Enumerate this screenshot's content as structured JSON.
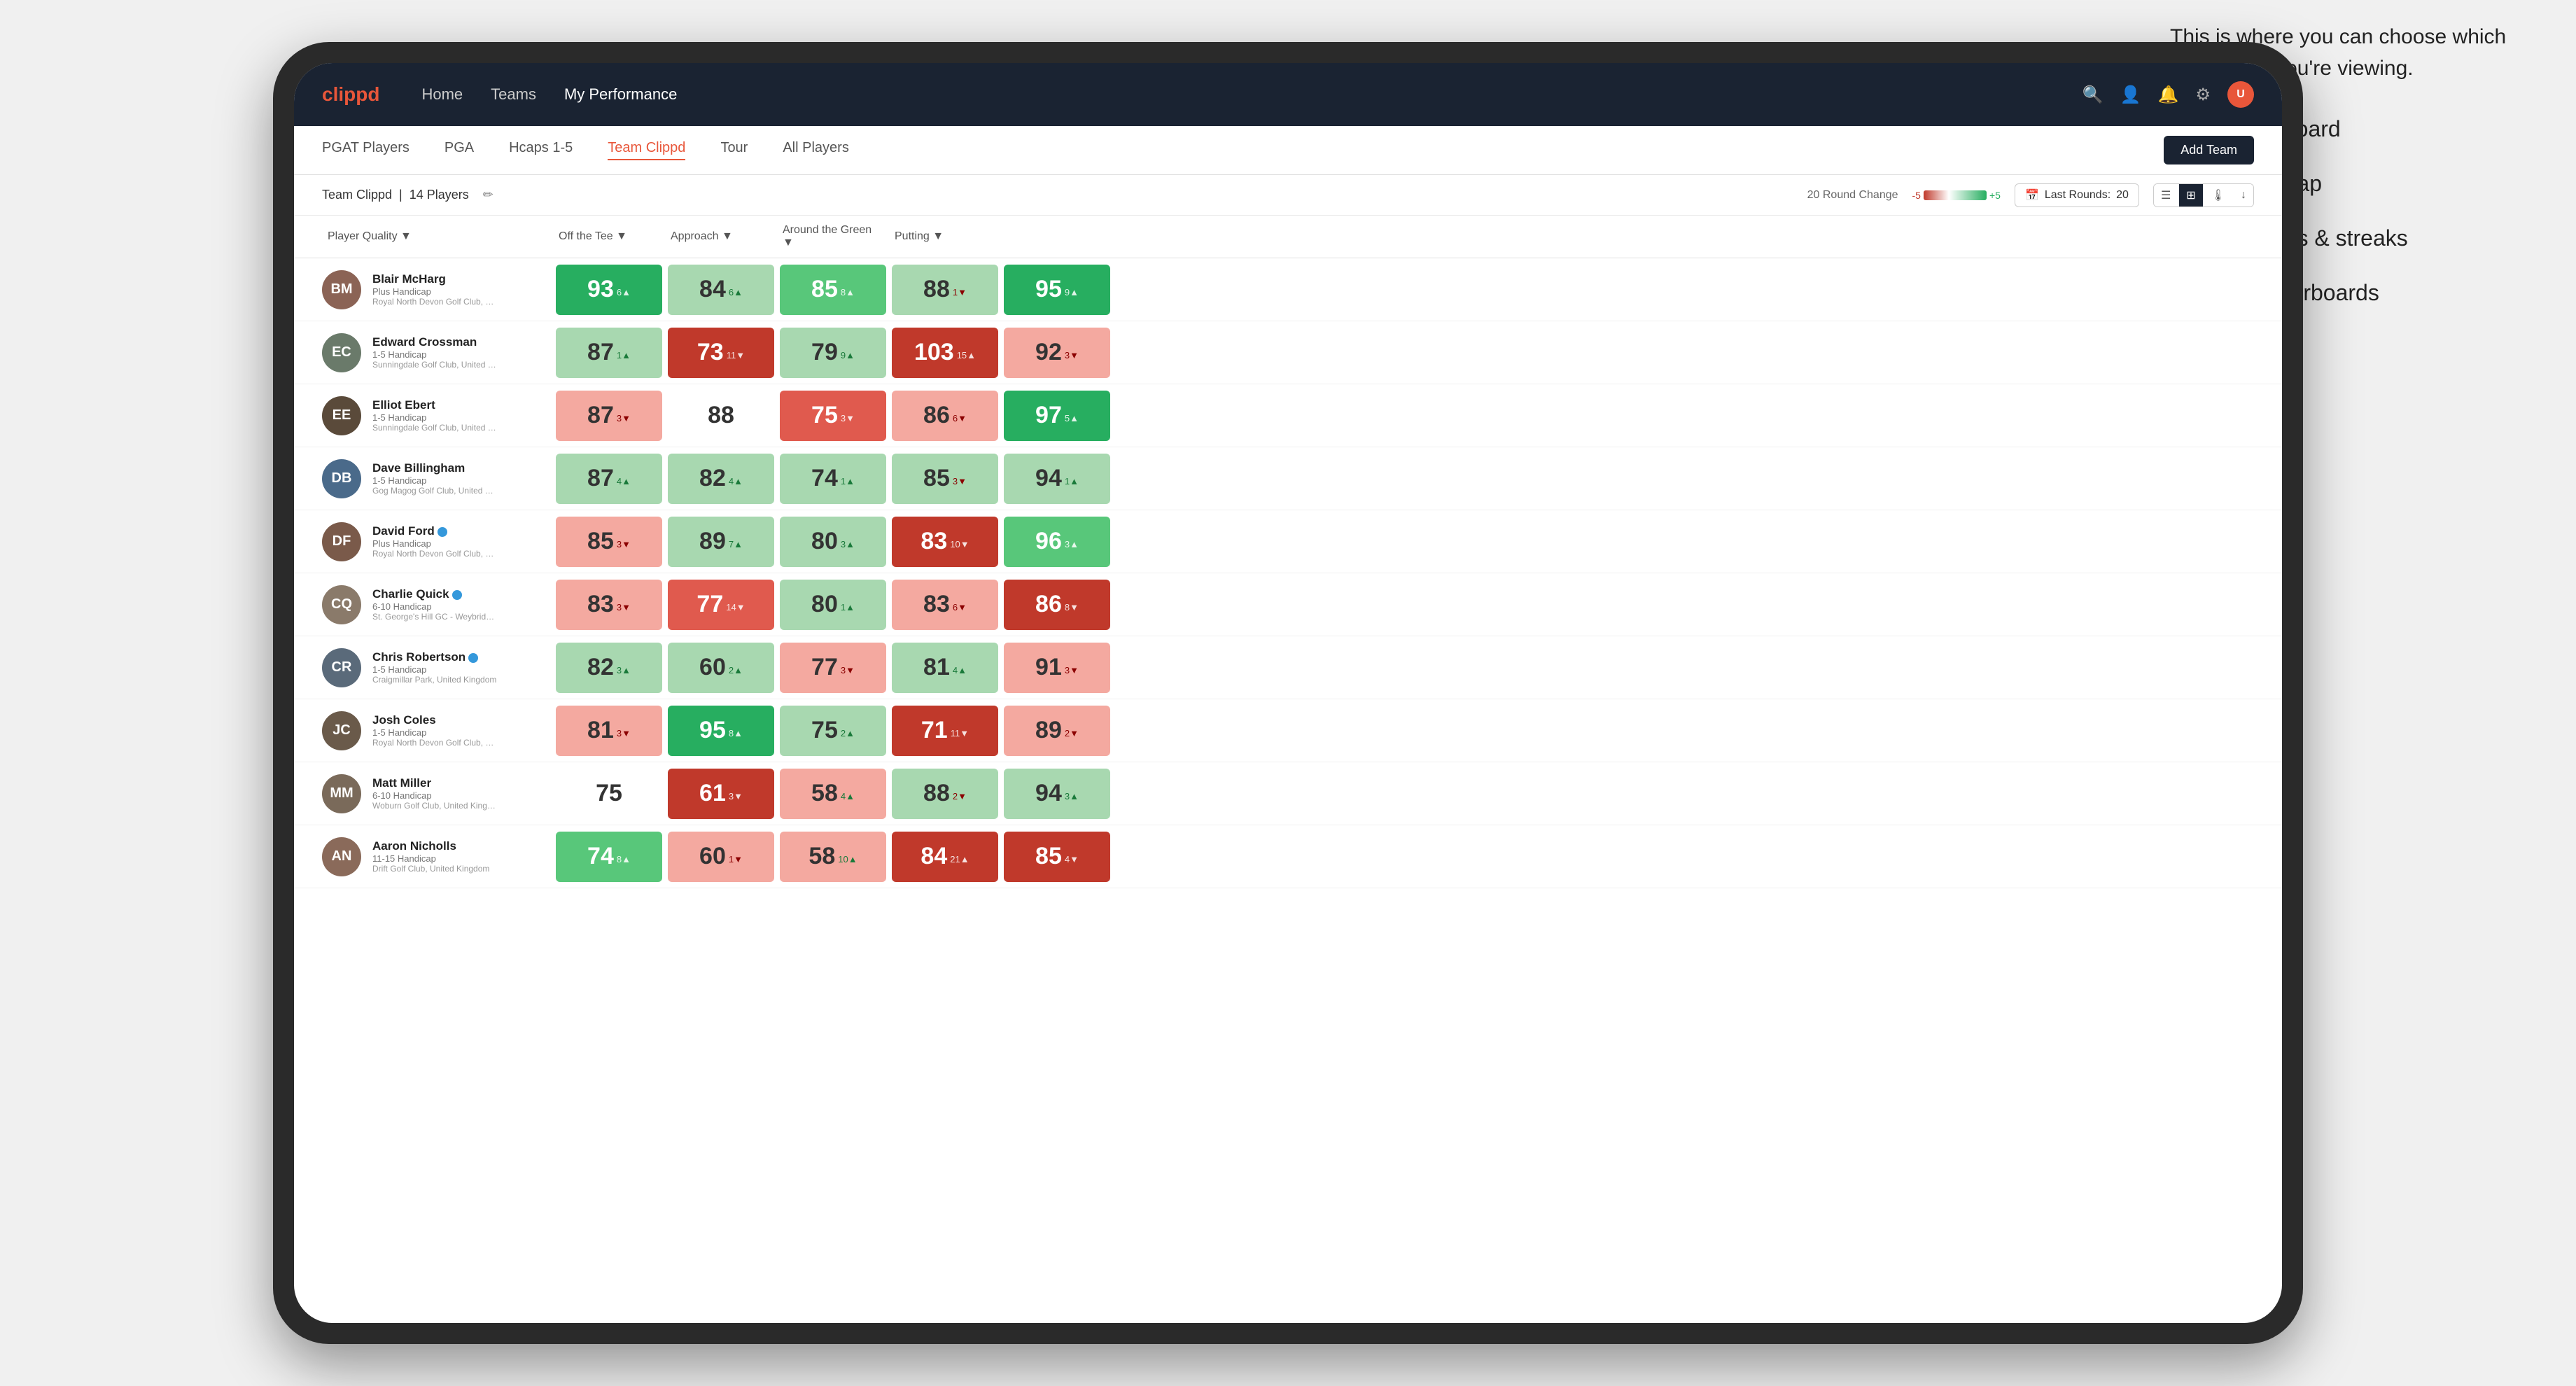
{
  "annotation": {
    "intro": "This is where you can choose which dashboard you're viewing.",
    "items": [
      "Team Dashboard",
      "Team Heatmap",
      "Leaderboards & streaks",
      "Course leaderboards"
    ]
  },
  "nav": {
    "logo": "clippd",
    "links": [
      "Home",
      "Teams",
      "My Performance"
    ],
    "active_link": "My Performance"
  },
  "sub_nav": {
    "links": [
      "PGAT Players",
      "PGA",
      "Hcaps 1-5",
      "Team Clippd",
      "Tour",
      "All Players"
    ],
    "active": "Team Clippd",
    "add_team_label": "Add Team"
  },
  "team_bar": {
    "name": "Team Clippd",
    "count": "14 Players",
    "round_change_label": "20 Round Change",
    "scale_neg": "-5",
    "scale_pos": "+5",
    "last_rounds_label": "Last Rounds:",
    "last_rounds_value": "20"
  },
  "table": {
    "columns": [
      "Player Quality ▼",
      "Off the Tee ▼",
      "Approach ▼",
      "Around the Green ▼",
      "Putting ▼"
    ],
    "players": [
      {
        "name": "Blair McHarg",
        "handicap": "Plus Handicap",
        "club": "Royal North Devon Golf Club, United Kingdom",
        "avatar_color": "#8B6355",
        "scores": [
          {
            "value": "93",
            "delta": "6",
            "dir": "up",
            "color": "green-dark"
          },
          {
            "value": "84",
            "delta": "6",
            "dir": "up",
            "color": "green-light"
          },
          {
            "value": "85",
            "delta": "8",
            "dir": "up",
            "color": "green-med"
          },
          {
            "value": "88",
            "delta": "1",
            "dir": "down",
            "color": "green-light"
          },
          {
            "value": "95",
            "delta": "9",
            "dir": "up",
            "color": "green-dark"
          }
        ]
      },
      {
        "name": "Edward Crossman",
        "handicap": "1-5 Handicap",
        "club": "Sunningdale Golf Club, United Kingdom",
        "avatar_color": "#6a7a6a",
        "scores": [
          {
            "value": "87",
            "delta": "1",
            "dir": "up",
            "color": "green-light"
          },
          {
            "value": "73",
            "delta": "11",
            "dir": "down",
            "color": "red-dark"
          },
          {
            "value": "79",
            "delta": "9",
            "dir": "up",
            "color": "green-light"
          },
          {
            "value": "103",
            "delta": "15",
            "dir": "up",
            "color": "red-dark"
          },
          {
            "value": "92",
            "delta": "3",
            "dir": "down",
            "color": "red-light"
          }
        ]
      },
      {
        "name": "Elliot Ebert",
        "handicap": "1-5 Handicap",
        "club": "Sunningdale Golf Club, United Kingdom",
        "avatar_color": "#5a4a3a",
        "scores": [
          {
            "value": "87",
            "delta": "3",
            "dir": "down",
            "color": "red-light"
          },
          {
            "value": "88",
            "delta": "",
            "dir": "none",
            "color": "white"
          },
          {
            "value": "75",
            "delta": "3",
            "dir": "down",
            "color": "red-med"
          },
          {
            "value": "86",
            "delta": "6",
            "dir": "down",
            "color": "red-light"
          },
          {
            "value": "97",
            "delta": "5",
            "dir": "up",
            "color": "green-dark"
          }
        ]
      },
      {
        "name": "Dave Billingham",
        "handicap": "1-5 Handicap",
        "club": "Gog Magog Golf Club, United Kingdom",
        "avatar_color": "#4a6a8a",
        "scores": [
          {
            "value": "87",
            "delta": "4",
            "dir": "up",
            "color": "green-light"
          },
          {
            "value": "82",
            "delta": "4",
            "dir": "up",
            "color": "green-light"
          },
          {
            "value": "74",
            "delta": "1",
            "dir": "up",
            "color": "green-light"
          },
          {
            "value": "85",
            "delta": "3",
            "dir": "down",
            "color": "green-light"
          },
          {
            "value": "94",
            "delta": "1",
            "dir": "up",
            "color": "green-light"
          }
        ]
      },
      {
        "name": "David Ford",
        "handicap": "Plus Handicap",
        "club": "Royal North Devon Golf Club, United Kingdom",
        "avatar_color": "#7a5a4a",
        "verified": true,
        "scores": [
          {
            "value": "85",
            "delta": "3",
            "dir": "down",
            "color": "red-light"
          },
          {
            "value": "89",
            "delta": "7",
            "dir": "up",
            "color": "green-light"
          },
          {
            "value": "80",
            "delta": "3",
            "dir": "up",
            "color": "green-light"
          },
          {
            "value": "83",
            "delta": "10",
            "dir": "down",
            "color": "red-dark"
          },
          {
            "value": "96",
            "delta": "3",
            "dir": "up",
            "color": "green-med"
          }
        ]
      },
      {
        "name": "Charlie Quick",
        "handicap": "6-10 Handicap",
        "club": "St. George's Hill GC - Weybridge - Surrey, Uni...",
        "avatar_color": "#8a7a6a",
        "verified": true,
        "scores": [
          {
            "value": "83",
            "delta": "3",
            "dir": "down",
            "color": "red-light"
          },
          {
            "value": "77",
            "delta": "14",
            "dir": "down",
            "color": "red-med"
          },
          {
            "value": "80",
            "delta": "1",
            "dir": "up",
            "color": "green-light"
          },
          {
            "value": "83",
            "delta": "6",
            "dir": "down",
            "color": "red-light"
          },
          {
            "value": "86",
            "delta": "8",
            "dir": "down",
            "color": "red-dark"
          }
        ]
      },
      {
        "name": "Chris Robertson",
        "handicap": "1-5 Handicap",
        "club": "Craigmillar Park, United Kingdom",
        "avatar_color": "#5a6a7a",
        "verified": true,
        "scores": [
          {
            "value": "82",
            "delta": "3",
            "dir": "up",
            "color": "green-light"
          },
          {
            "value": "60",
            "delta": "2",
            "dir": "up",
            "color": "green-light"
          },
          {
            "value": "77",
            "delta": "3",
            "dir": "down",
            "color": "red-light"
          },
          {
            "value": "81",
            "delta": "4",
            "dir": "up",
            "color": "green-light"
          },
          {
            "value": "91",
            "delta": "3",
            "dir": "down",
            "color": "red-light"
          }
        ]
      },
      {
        "name": "Josh Coles",
        "handicap": "1-5 Handicap",
        "club": "Royal North Devon Golf Club, United Kingdom",
        "avatar_color": "#6a5a4a",
        "scores": [
          {
            "value": "81",
            "delta": "3",
            "dir": "down",
            "color": "red-light"
          },
          {
            "value": "95",
            "delta": "8",
            "dir": "up",
            "color": "green-dark"
          },
          {
            "value": "75",
            "delta": "2",
            "dir": "up",
            "color": "green-light"
          },
          {
            "value": "71",
            "delta": "11",
            "dir": "down",
            "color": "red-dark"
          },
          {
            "value": "89",
            "delta": "2",
            "dir": "down",
            "color": "red-light"
          }
        ]
      },
      {
        "name": "Matt Miller",
        "handicap": "6-10 Handicap",
        "club": "Woburn Golf Club, United Kingdom",
        "avatar_color": "#7a6a5a",
        "scores": [
          {
            "value": "75",
            "delta": "",
            "dir": "none",
            "color": "white"
          },
          {
            "value": "61",
            "delta": "3",
            "dir": "down",
            "color": "red-dark"
          },
          {
            "value": "58",
            "delta": "4",
            "dir": "up",
            "color": "red-light"
          },
          {
            "value": "88",
            "delta": "2",
            "dir": "down",
            "color": "green-light"
          },
          {
            "value": "94",
            "delta": "3",
            "dir": "up",
            "color": "green-light"
          }
        ]
      },
      {
        "name": "Aaron Nicholls",
        "handicap": "11-15 Handicap",
        "club": "Drift Golf Club, United Kingdom",
        "avatar_color": "#8a6a5a",
        "scores": [
          {
            "value": "74",
            "delta": "8",
            "dir": "up",
            "color": "green-med"
          },
          {
            "value": "60",
            "delta": "1",
            "dir": "down",
            "color": "red-light"
          },
          {
            "value": "58",
            "delta": "10",
            "dir": "up",
            "color": "red-light"
          },
          {
            "value": "84",
            "delta": "21",
            "dir": "up",
            "color": "red-dark"
          },
          {
            "value": "85",
            "delta": "4",
            "dir": "down",
            "color": "red-dark"
          }
        ]
      }
    ]
  },
  "colors": {
    "green_dark": "#27ae60",
    "green_med": "#58c77a",
    "green_light": "#a8d8b0",
    "white": "#ffffff",
    "red_light": "#f4a9a0",
    "red_med": "#e05a4e",
    "red_dark": "#c0392b",
    "nav_bg": "#1a2332",
    "brand": "#e8563a"
  }
}
